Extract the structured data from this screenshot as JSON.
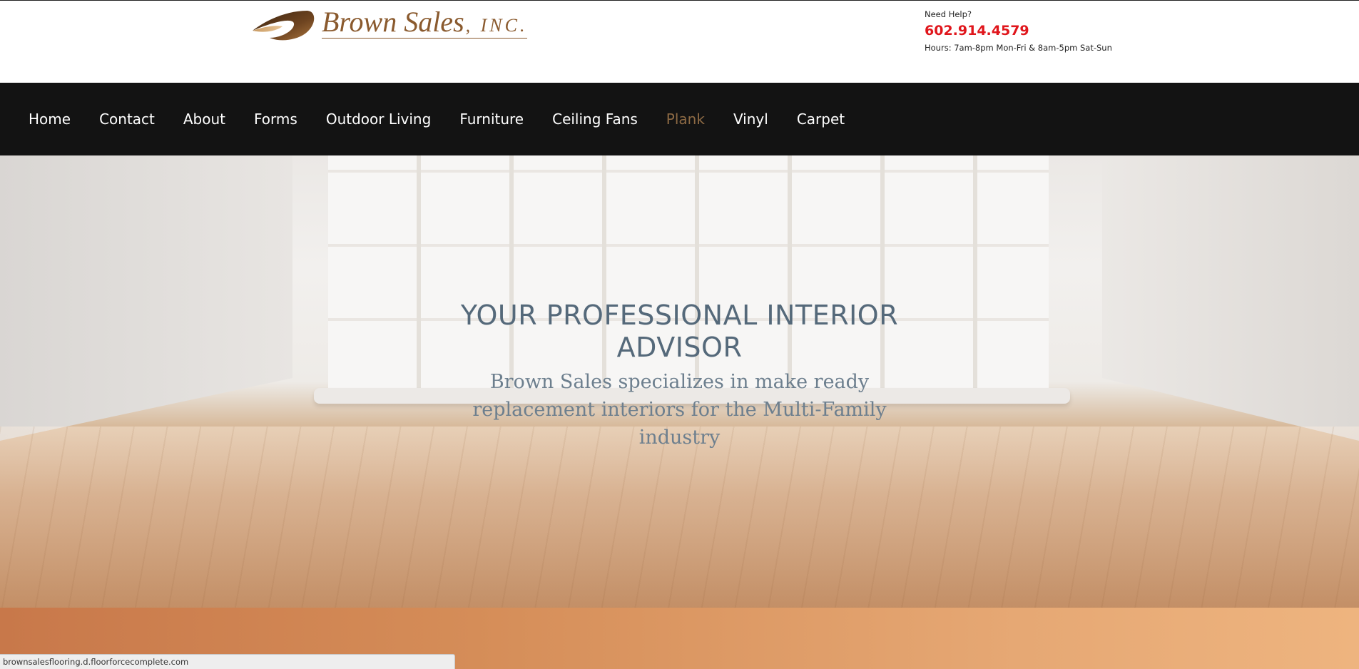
{
  "header": {
    "logo": {
      "name": "Brown Sales",
      "suffix": ", INC.",
      "color": "#8a5a2e"
    },
    "help": {
      "label": "Need Help?",
      "phone": "602.914.4579",
      "hours": "Hours: 7am-8pm Mon-Fri & 8am-5pm Sat-Sun",
      "phone_color": "#e0161c"
    }
  },
  "nav": {
    "background": "#131313",
    "active_color": "#8d6a44",
    "items": [
      {
        "label": "Home"
      },
      {
        "label": "Contact"
      },
      {
        "label": "About"
      },
      {
        "label": "Forms"
      },
      {
        "label": "Outdoor Living"
      },
      {
        "label": "Furniture"
      },
      {
        "label": "Ceiling Fans"
      },
      {
        "label": "Plank",
        "active": true
      },
      {
        "label": "Vinyl"
      },
      {
        "label": "Carpet"
      }
    ]
  },
  "hero": {
    "title": "YOUR PROFESSIONAL INTERIOR ADVISOR",
    "subtitle": "Brown Sales specializes in make ready replacement interiors for the Multi-Family industry",
    "title_color": "#55697a"
  },
  "status_url": "brownsalesflooring.d.floorforcecomplete.com"
}
